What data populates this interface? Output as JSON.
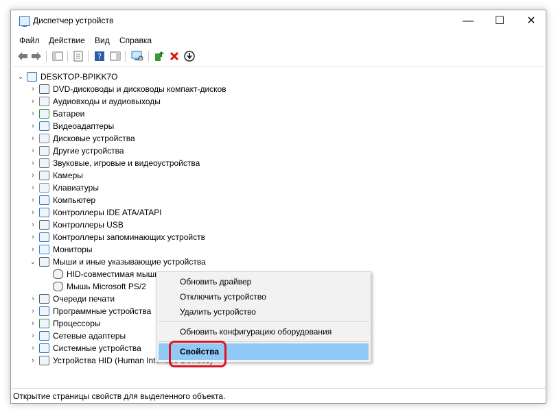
{
  "window": {
    "title": "Диспетчер устройств",
    "minimize": "—",
    "maximize": "☐",
    "close": "✕"
  },
  "menu": [
    "Файл",
    "Действие",
    "Вид",
    "Справка"
  ],
  "tree": {
    "root": "DESKTOP-BPIKK7O",
    "categories": [
      "DVD-дисководы и дисководы компакт-дисков",
      "Аудиовходы и аудиовыходы",
      "Батареи",
      "Видеоадаптеры",
      "Дисковые устройства",
      "Другие устройства",
      "Звуковые, игровые и видеоустройства",
      "Камеры",
      "Клавиатуры",
      "Компьютер",
      "Контроллеры IDE ATA/ATAPI",
      "Контроллеры USB",
      "Контроллеры запоминающих устройств",
      "Мониторы",
      "Мыши и иные указывающие устройства",
      "Очереди печати",
      "Программные устройства",
      "Процессоры",
      "Сетевые адаптеры",
      "Системные устройства",
      "Устройства HID (Human Interface Devices)"
    ],
    "mice_children": [
      "HID-совместимая мышь",
      "Мышь Microsoft PS/2"
    ]
  },
  "context_menu": {
    "items": [
      "Обновить драйвер",
      "Отключить устройство",
      "Удалить устройство"
    ],
    "scan": "Обновить конфигурацию оборудования",
    "properties": "Свойства"
  },
  "status": "Открытие страницы свойств для выделенного объекта.",
  "colors": {
    "highlight": "#91c9f7",
    "selection": "#cce8ff",
    "annotation": "#e0121f"
  }
}
